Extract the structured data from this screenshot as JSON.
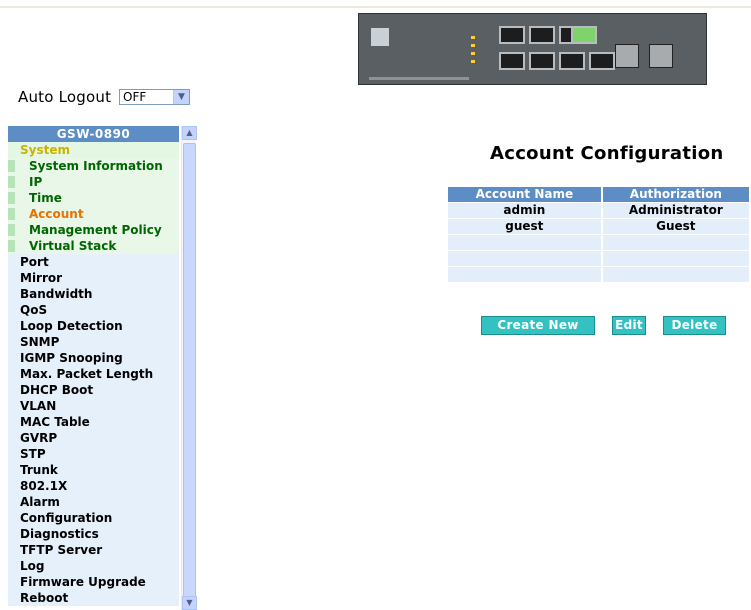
{
  "auto_logout": {
    "label": "Auto Logout",
    "value": "OFF"
  },
  "sidebar": {
    "header": "GSW-0890",
    "items": [
      {
        "label": "System",
        "level": "top",
        "state": "expanded"
      },
      {
        "label": "System Information",
        "level": "sub"
      },
      {
        "label": "IP",
        "level": "sub"
      },
      {
        "label": "Time",
        "level": "sub"
      },
      {
        "label": "Account",
        "level": "sub",
        "state": "active"
      },
      {
        "label": "Management Policy",
        "level": "sub"
      },
      {
        "label": "Virtual Stack",
        "level": "sub"
      },
      {
        "label": "Port",
        "level": "top"
      },
      {
        "label": "Mirror",
        "level": "top"
      },
      {
        "label": "Bandwidth",
        "level": "top"
      },
      {
        "label": "QoS",
        "level": "top"
      },
      {
        "label": "Loop Detection",
        "level": "top"
      },
      {
        "label": "SNMP",
        "level": "top"
      },
      {
        "label": "IGMP Snooping",
        "level": "top"
      },
      {
        "label": "Max. Packet Length",
        "level": "top"
      },
      {
        "label": "DHCP Boot",
        "level": "top"
      },
      {
        "label": "VLAN",
        "level": "top"
      },
      {
        "label": "MAC Table",
        "level": "top"
      },
      {
        "label": "GVRP",
        "level": "top"
      },
      {
        "label": "STP",
        "level": "top"
      },
      {
        "label": "Trunk",
        "level": "top"
      },
      {
        "label": "802.1X",
        "level": "top"
      },
      {
        "label": "Alarm",
        "level": "top"
      },
      {
        "label": "Configuration",
        "level": "top"
      },
      {
        "label": "Diagnostics",
        "level": "top"
      },
      {
        "label": "TFTP Server",
        "level": "top"
      },
      {
        "label": "Log",
        "level": "top"
      },
      {
        "label": "Firmware Upgrade",
        "level": "top"
      },
      {
        "label": "Reboot",
        "level": "top"
      }
    ]
  },
  "main": {
    "title": "Account Configuration",
    "table": {
      "columns": [
        "Account Name",
        "Authorization"
      ],
      "rows": [
        [
          "admin",
          "Administrator"
        ],
        [
          "guest",
          "Guest"
        ],
        [
          "",
          ""
        ],
        [
          "",
          ""
        ],
        [
          "",
          ""
        ]
      ]
    },
    "buttons": {
      "create": "Create New",
      "edit": "Edit",
      "delete": "Delete"
    }
  },
  "icons": {
    "device": "switch-front-panel-image",
    "scroll_up": "scroll-up-arrow-icon",
    "scroll_down": "scroll-down-arrow-icon",
    "dropdown": "chevron-down-icon"
  },
  "colors": {
    "header_blue": "#5c8dc5",
    "row_blue": "#e4eefb",
    "sub_green": "#e8f7e8",
    "active_orange": "#e67300",
    "system_yellow": "#c8b400",
    "button_teal": "#33c1c1"
  }
}
